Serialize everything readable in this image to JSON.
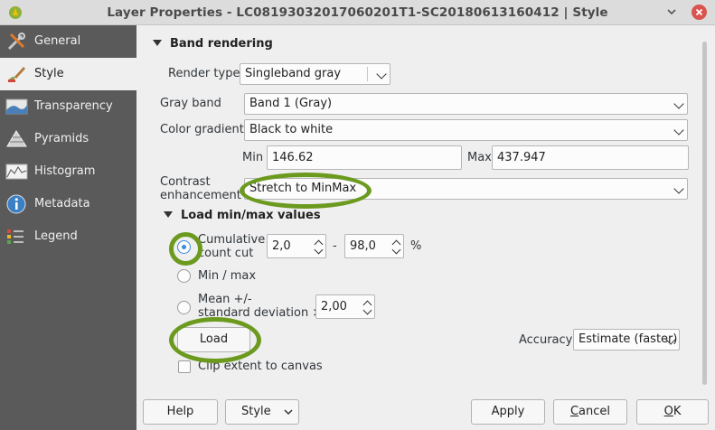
{
  "window": {
    "title": "Layer Properties - LC08193032017060201T1-SC20180613160412 | Style",
    "minimize_icon": "chevron-down-icon",
    "close_icon": "close-icon"
  },
  "sidebar": {
    "items": [
      {
        "label": "General",
        "icon": "wrench-screwdriver-icon"
      },
      {
        "label": "Style",
        "icon": "paintbrush-icon"
      },
      {
        "label": "Transparency",
        "icon": "transparency-icon"
      },
      {
        "label": "Pyramids",
        "icon": "pyramid-icon"
      },
      {
        "label": "Histogram",
        "icon": "histogram-icon"
      },
      {
        "label": "Metadata",
        "icon": "info-icon"
      },
      {
        "label": "Legend",
        "icon": "legend-icon"
      }
    ],
    "active": "Style"
  },
  "band_rendering": {
    "header": "Band rendering",
    "render_type_label": "Render type",
    "render_type_value": "Singleband gray",
    "gray_band_label": "Gray band",
    "gray_band_value": "Band 1 (Gray)",
    "color_gradient_label": "Color gradient",
    "color_gradient_value": "Black to white",
    "min_label": "Min",
    "min_value": "146.62",
    "max_label": "Max",
    "max_value": "437.947",
    "contrast_label_line1": "Contrast",
    "contrast_label_line2": "enhancement",
    "contrast_value": "Stretch to MinMax"
  },
  "minmax": {
    "header": "Load min/max values",
    "cumulative_line1": "Cumulative",
    "cumulative_line2": "count cut",
    "cumulative_low": "2,0",
    "dash": "-",
    "cumulative_high": "98,0",
    "percent": "%",
    "minmax_label": "Min / max",
    "meanstd_line1": "Mean +/-",
    "meanstd_line2": "standard deviation ×",
    "meanstd_value": "2,00",
    "selected": "cumulative",
    "load_button": "Load",
    "accuracy_label": "Accuracy",
    "accuracy_value": "Estimate (faster)",
    "clip_label": "Clip extent to canvas"
  },
  "buttons": {
    "help": "Help",
    "style": "Style",
    "apply": "Apply",
    "cancel_pre": "",
    "cancel_u": "C",
    "cancel_post": "ancel",
    "ok_u": "O",
    "ok_post": "K"
  },
  "colors": {
    "highlight": "#6b9a1f",
    "sidebar_bg": "#5a5a5a",
    "radio_accent": "#3d8ae0"
  }
}
